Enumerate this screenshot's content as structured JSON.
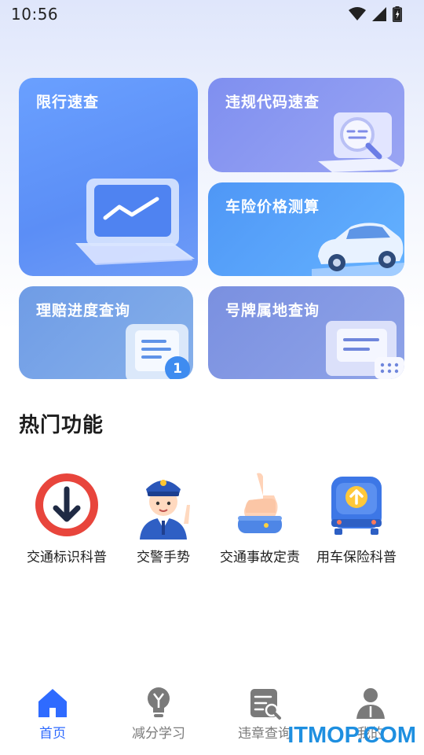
{
  "status_bar": {
    "time": "10:56",
    "icons": [
      "wifi-icon",
      "signal-icon",
      "battery-charging-icon"
    ]
  },
  "cards": {
    "limit": {
      "label": "限行速查",
      "icon": "chart-screen-icon"
    },
    "code": {
      "label": "违规代码速查",
      "icon": "magnifier-document-icon"
    },
    "insure": {
      "label": "车险价格测算",
      "icon": "car-icon"
    },
    "claim": {
      "label": "理赔进度查询",
      "icon": "document-badge-icon",
      "badge": "1"
    },
    "plate": {
      "label": "号牌属地查询",
      "icon": "card-dots-icon"
    }
  },
  "hot": {
    "title": "热门功能",
    "items": [
      {
        "label": "交通标识科普",
        "icon": "down-arrow-sign-icon"
      },
      {
        "label": "交警手势",
        "icon": "police-officer-icon"
      },
      {
        "label": "交通事故定责",
        "icon": "pointing-hand-icon"
      },
      {
        "label": "用车保险科普",
        "icon": "car-upload-icon"
      }
    ]
  },
  "nav": {
    "items": [
      {
        "label": "首页",
        "icon": "home-icon",
        "active": true
      },
      {
        "label": "减分学习",
        "icon": "lightbulb-icon",
        "active": false
      },
      {
        "label": "违章查询",
        "icon": "document-search-icon",
        "active": false
      },
      {
        "label": "我的",
        "icon": "person-icon",
        "active": false
      }
    ]
  },
  "colors": {
    "accent": "#2f6bff",
    "nav_inactive": "#7a7a7a",
    "watermark": "#1e8fe0"
  },
  "watermark": "ITMOP.COM"
}
